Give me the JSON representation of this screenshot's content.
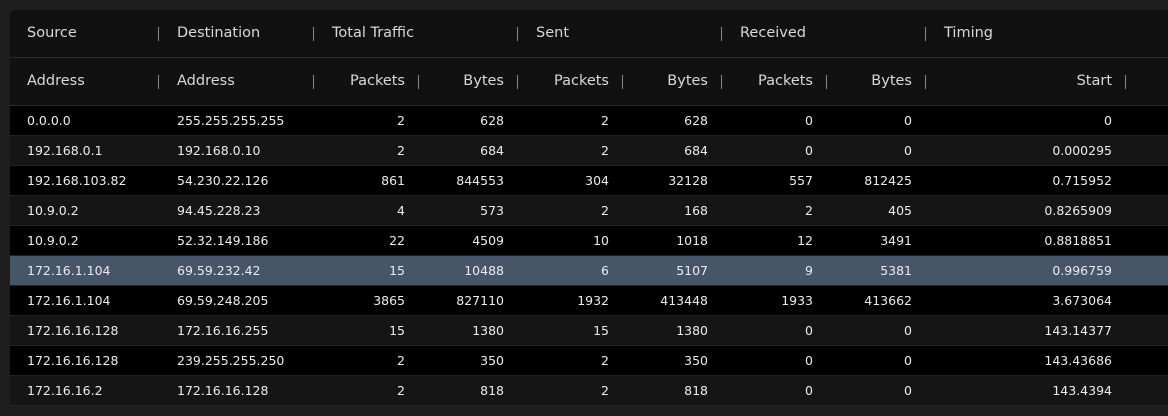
{
  "groups": [
    {
      "key": "source",
      "label": "Source"
    },
    {
      "key": "destination",
      "label": "Destination"
    },
    {
      "key": "total",
      "label": "Total Traffic"
    },
    {
      "key": "sent",
      "label": "Sent"
    },
    {
      "key": "received",
      "label": "Received"
    },
    {
      "key": "timing",
      "label": "Timing"
    }
  ],
  "columns": [
    {
      "key": "src",
      "label": "Address"
    },
    {
      "key": "dst",
      "label": "Address"
    },
    {
      "key": "tp",
      "label": "Packets"
    },
    {
      "key": "tb",
      "label": "Bytes"
    },
    {
      "key": "sp",
      "label": "Packets"
    },
    {
      "key": "sb",
      "label": "Bytes"
    },
    {
      "key": "rp",
      "label": "Packets"
    },
    {
      "key": "rb",
      "label": "Bytes"
    },
    {
      "key": "start",
      "label": "Start"
    }
  ],
  "selected_row": 5,
  "colors": {
    "selected": "#475569",
    "header": "#111111",
    "row_alt": "#151515"
  },
  "rows": [
    [
      "0.0.0.0",
      "255.255.255.255",
      "2",
      "628",
      "2",
      "628",
      "0",
      "0",
      "0"
    ],
    [
      "192.168.0.1",
      "192.168.0.10",
      "2",
      "684",
      "2",
      "684",
      "0",
      "0",
      "0.000295"
    ],
    [
      "192.168.103.82",
      "54.230.22.126",
      "861",
      "844553",
      "304",
      "32128",
      "557",
      "812425",
      "0.715952"
    ],
    [
      "10.9.0.2",
      "94.45.228.23",
      "4",
      "573",
      "2",
      "168",
      "2",
      "405",
      "0.8265909"
    ],
    [
      "10.9.0.2",
      "52.32.149.186",
      "22",
      "4509",
      "10",
      "1018",
      "12",
      "3491",
      "0.8818851"
    ],
    [
      "172.16.1.104",
      "69.59.232.42",
      "15",
      "10488",
      "6",
      "5107",
      "9",
      "5381",
      "0.996759"
    ],
    [
      "172.16.1.104",
      "69.59.248.205",
      "3865",
      "827110",
      "1932",
      "413448",
      "1933",
      "413662",
      "3.673064"
    ],
    [
      "172.16.16.128",
      "172.16.16.255",
      "15",
      "1380",
      "15",
      "1380",
      "0",
      "0",
      "143.14377"
    ],
    [
      "172.16.16.128",
      "239.255.255.250",
      "2",
      "350",
      "2",
      "350",
      "0",
      "0",
      "143.43686"
    ],
    [
      "172.16.16.2",
      "172.16.16.128",
      "2",
      "818",
      "2",
      "818",
      "0",
      "0",
      "143.4394"
    ]
  ]
}
